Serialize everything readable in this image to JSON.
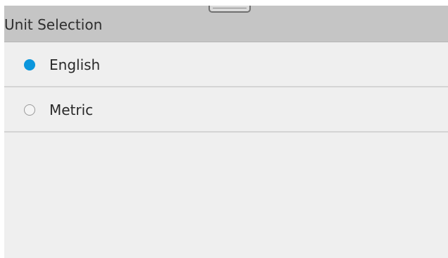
{
  "header": {
    "title": "Unit Selection"
  },
  "options": [
    {
      "label": "English",
      "selected": true
    },
    {
      "label": "Metric",
      "selected": false
    }
  ],
  "colors": {
    "accent": "#0b96dc",
    "header_bg": "#c5c5c5",
    "panel_bg": "#efefef"
  }
}
